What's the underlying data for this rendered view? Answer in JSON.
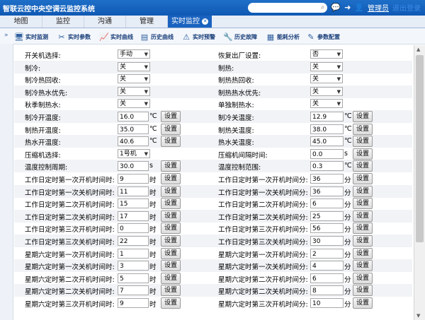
{
  "header": {
    "title": "智联云控中央空调云监控系统",
    "admin_label": "管理员",
    "logout_label": "退出登录"
  },
  "nav": {
    "tabs": [
      {
        "label": "地图"
      },
      {
        "label": "监控"
      },
      {
        "label": "沟通"
      },
      {
        "label": "管理"
      },
      {
        "label": "实时监控"
      }
    ]
  },
  "toolbar": {
    "items": [
      {
        "label": "实时监测",
        "icon": "monitor-icon"
      },
      {
        "label": "实时参数",
        "icon": "tools-icon"
      },
      {
        "label": "实时曲线",
        "icon": "curve-icon"
      },
      {
        "label": "历史曲线",
        "icon": "history-curve-icon"
      },
      {
        "label": "实时预警",
        "icon": "warning-icon"
      },
      {
        "label": "历史故障",
        "icon": "wrench-icon"
      },
      {
        "label": "能耗分析",
        "icon": "energy-icon"
      },
      {
        "label": "参数配置",
        "icon": "edit-icon"
      }
    ]
  },
  "form": {
    "rows": [
      {
        "left": {
          "label": "开关机选择:",
          "type": "select",
          "value": "手动"
        },
        "right": {
          "label": "恢复出厂设置:",
          "type": "select",
          "value": "否"
        }
      },
      {
        "left": {
          "label": "制冷:",
          "type": "select",
          "value": "关"
        },
        "right": {
          "label": "制热:",
          "type": "select",
          "value": "关"
        }
      },
      {
        "left": {
          "label": "制冷热回收:",
          "type": "select",
          "value": "关"
        },
        "right": {
          "label": "制热热回收:",
          "type": "select",
          "value": "关"
        }
      },
      {
        "left": {
          "label": "制冷热水优先:",
          "type": "select",
          "value": "关"
        },
        "right": {
          "label": "制热热水优先:",
          "type": "select",
          "value": "关"
        }
      },
      {
        "left": {
          "label": "秋季制热水:",
          "type": "select",
          "value": "关"
        },
        "right": {
          "label": "单独制热水:",
          "type": "select",
          "value": "关"
        }
      },
      {
        "left": {
          "label": "制冷开温度:",
          "type": "input",
          "value": "16.0",
          "unit": "℃"
        },
        "right": {
          "label": "制冷关温度:",
          "type": "input",
          "value": "12.9",
          "unit": "℃"
        }
      },
      {
        "left": {
          "label": "制热开温度:",
          "type": "input",
          "value": "35.0",
          "unit": "℃"
        },
        "right": {
          "label": "制热关温度:",
          "type": "input",
          "value": "38.0",
          "unit": "℃"
        }
      },
      {
        "left": {
          "label": "热水开温度:",
          "type": "input",
          "value": "40.6",
          "unit": "℃"
        },
        "right": {
          "label": "热水关温度:",
          "type": "input",
          "value": "45.0",
          "unit": "℃"
        }
      },
      {
        "left": {
          "label": "压缩机选择:",
          "type": "select",
          "value": "1号机"
        },
        "right": {
          "label": "压缩机间隔时间:",
          "type": "input",
          "value": "0.0",
          "unit": "s"
        }
      },
      {
        "left": {
          "label": "温度控制周期:",
          "type": "input",
          "value": "30.0",
          "unit": "s"
        },
        "right": {
          "label": "温度控制范围:",
          "type": "input",
          "value": "0.3",
          "unit": "℃"
        }
      },
      {
        "left": {
          "label": "工作日定时第一次开机时间时:",
          "type": "input",
          "value": "9",
          "unit": "时"
        },
        "right": {
          "label": "工作日定时第一次开机时间分:",
          "type": "input",
          "value": "36",
          "unit": "分"
        }
      },
      {
        "left": {
          "label": "工作日定时第一次关机时间时:",
          "type": "input",
          "value": "11",
          "unit": "时"
        },
        "right": {
          "label": "工作日定时第一次关机时间分:",
          "type": "input",
          "value": "36",
          "unit": "分"
        }
      },
      {
        "left": {
          "label": "工作日定时第二次开机时间时:",
          "type": "input",
          "value": "15",
          "unit": "时"
        },
        "right": {
          "label": "工作日定时第二次开机时间分:",
          "type": "input",
          "value": "6",
          "unit": "分"
        }
      },
      {
        "left": {
          "label": "工作日定时第二次关机时间时:",
          "type": "input",
          "value": "17",
          "unit": "时"
        },
        "right": {
          "label": "工作日定时第二次关机时间分:",
          "type": "input",
          "value": "25",
          "unit": "分"
        }
      },
      {
        "left": {
          "label": "工作日定时第三次开机时间时:",
          "type": "input",
          "value": "0",
          "unit": "时"
        },
        "right": {
          "label": "工作日定时第三次开机时间分:",
          "type": "input",
          "value": "56",
          "unit": "分"
        }
      },
      {
        "left": {
          "label": "工作日定时第三次关机时间时:",
          "type": "input",
          "value": "22",
          "unit": "时"
        },
        "right": {
          "label": "工作日定时第三次关机时间分:",
          "type": "input",
          "value": "30",
          "unit": "分"
        }
      },
      {
        "left": {
          "label": "星期六定时第一次开机时间时:",
          "type": "input",
          "value": "1",
          "unit": "时"
        },
        "right": {
          "label": "星期六定时第一次开机时间分:",
          "type": "input",
          "value": "2",
          "unit": "分"
        }
      },
      {
        "left": {
          "label": "星期六定时第一次关机时间时:",
          "type": "input",
          "value": "3",
          "unit": "时"
        },
        "right": {
          "label": "星期六定时第一次关机时间分:",
          "type": "input",
          "value": "4",
          "unit": "分"
        }
      },
      {
        "left": {
          "label": "星期六定时第二次开机时间时:",
          "type": "input",
          "value": "5",
          "unit": "时"
        },
        "right": {
          "label": "星期六定时第二次开机时间分:",
          "type": "input",
          "value": "6",
          "unit": "分"
        }
      },
      {
        "left": {
          "label": "星期六定时第二次关机时间时:",
          "type": "input",
          "value": "7",
          "unit": "时"
        },
        "right": {
          "label": "星期六定时第二次关机时间分:",
          "type": "input",
          "value": "8",
          "unit": "分"
        }
      },
      {
        "left": {
          "label": "星期六定时第三次开机时间时:",
          "type": "input",
          "value": "9",
          "unit": "时"
        },
        "right": {
          "label": "星期六定时第三次开机时间分:",
          "type": "input",
          "value": "10",
          "unit": "分"
        }
      }
    ],
    "set_button_label": "设置"
  }
}
